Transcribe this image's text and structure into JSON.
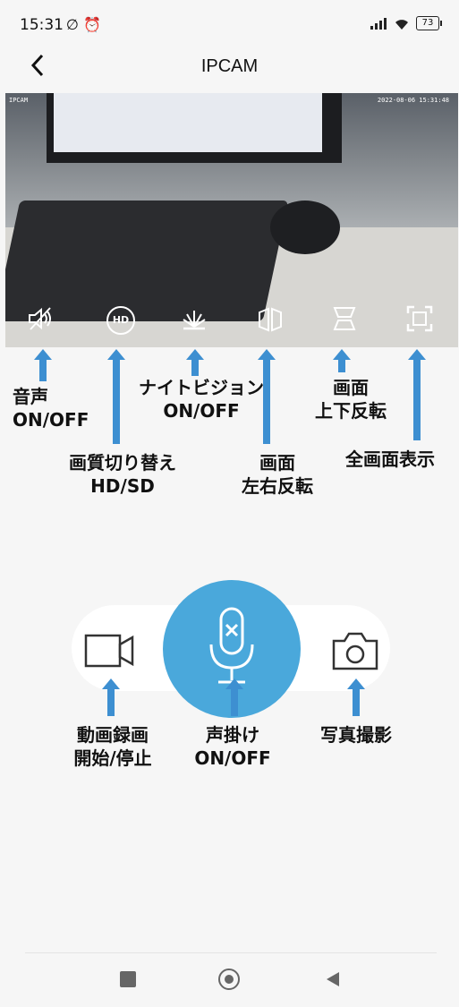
{
  "status_bar": {
    "time": "15:31",
    "battery": "73"
  },
  "header": {
    "title": "IPCAM"
  },
  "video": {
    "camera_label": "IPCAM",
    "timestamp": "2022-08-06 15:31:48"
  },
  "annotations": {
    "sound": [
      "音声",
      "ON/OFF"
    ],
    "quality": [
      "画質切り替え",
      "HD/SD"
    ],
    "night_vision": [
      "ナイトビジョン",
      "ON/OFF"
    ],
    "mirror": [
      "画面",
      "左右反転"
    ],
    "flip": [
      "画面",
      "上下反転"
    ],
    "fullscreen": [
      "全画面表示"
    ],
    "record": [
      "動画録画",
      "開始/停止"
    ],
    "talk": [
      "声掛け",
      "ON/OFF"
    ],
    "photo": [
      "写真撮影"
    ]
  },
  "icons": {
    "hd_badge": "HD"
  },
  "colors": {
    "accent": "#4aa8db",
    "arrow": "#3d8fd1"
  }
}
